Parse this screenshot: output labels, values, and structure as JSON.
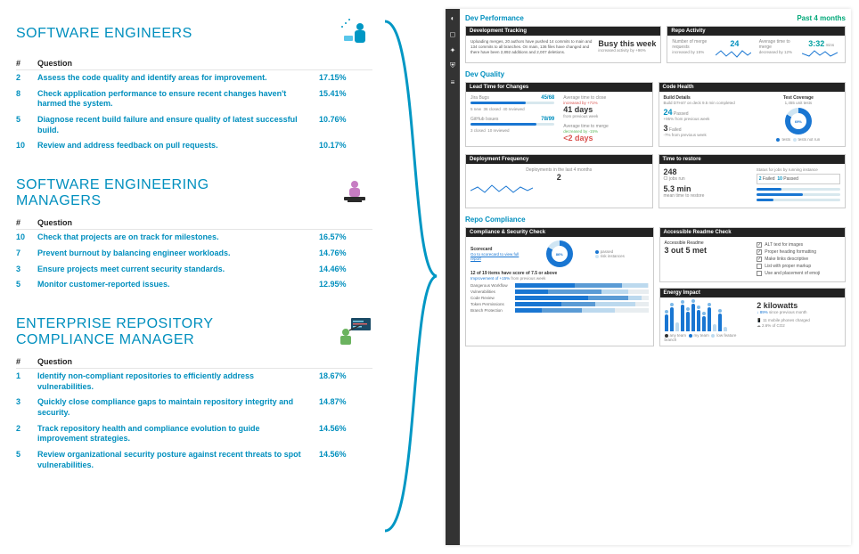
{
  "personas": {
    "se": {
      "title": "SOFTWARE ENGINEERS",
      "rows": [
        {
          "n": "2",
          "q": "Assess the code quality and identify areas for improvement.",
          "pct": "17.15%"
        },
        {
          "n": "8",
          "q": "Check application performance to ensure recent changes haven't harmed the system.",
          "pct": "15.41%"
        },
        {
          "n": "5",
          "q": "Diagnose recent build failure and ensure quality of latest successful build.",
          "pct": "10.76%"
        },
        {
          "n": "10",
          "q": "Review and address feedback on pull requests.",
          "pct": "10.17%"
        }
      ]
    },
    "sem": {
      "title": "SOFTWARE ENGINEERING MANAGERS",
      "rows": [
        {
          "n": "10",
          "q": "Check that projects are on track for milestones.",
          "pct": "16.57%"
        },
        {
          "n": "7",
          "q": "Prevent burnout by balancing engineer workloads.",
          "pct": "14.76%"
        },
        {
          "n": "3",
          "q": "Ensure projects meet current security standards.",
          "pct": "14.46%"
        },
        {
          "n": "5",
          "q": "Monitor customer-reported issues.",
          "pct": "12.95%"
        }
      ]
    },
    "erc": {
      "title": "ENTERPRISE REPOSITORY COMPLIANCE MANAGER",
      "rows": [
        {
          "n": "1",
          "q": "Identify non-compliant repositories to efficiently address vulnerabilities.",
          "pct": "18.67%"
        },
        {
          "n": "3",
          "q": "Quickly close compliance gaps to maintain repository integrity and security.",
          "pct": "14.87%"
        },
        {
          "n": "2",
          "q": "Track repository health and compliance evolution to guide improvement strategies.",
          "pct": "14.56%"
        },
        {
          "n": "5",
          "q": "Review organizational security posture against recent threats to spot vulnerabilities.",
          "pct": "14.56%"
        }
      ]
    },
    "headers": {
      "num": "#",
      "question": "Question"
    }
  },
  "dash": {
    "perf": {
      "title": "Dev Performance",
      "range": "Past 4 months"
    },
    "devtrack": {
      "title": "Development Tracking",
      "summary": "Uploading merges, 20 authors have pushed 14 commits to main and 134 commits to all branches. On main, 136 files have changed and there have been 2,892 additions and 2,007 deletions.",
      "busy": "Busy this week",
      "busy_sub": "increased activity by +96%"
    },
    "repoact": {
      "title": "Repo Activity",
      "merge_label": "Number of merge requests",
      "merge_val": "24",
      "merge_sub": "increased by 15%",
      "time_label": "Average time to merge",
      "time_val": "3:32",
      "time_unit": "mins",
      "time_sub": "decreased by 12%"
    },
    "quality": {
      "title": "Dev Quality"
    },
    "lead": {
      "title": "Lead Time for Changes",
      "bugs_label": "Jira Bugs",
      "bugs_val": "45/68",
      "bugs_legend": [
        "5 new",
        "36 closed",
        "40 reviewed"
      ],
      "close_label": "Average time to close",
      "close_change": "increased by +71%",
      "close_val": "41 days",
      "close_sub": "from previous week",
      "gh_label": "GitHub Issues",
      "gh_val": "78/99",
      "gh_legend": [
        "3 closed",
        "10 reviewed"
      ],
      "merge_label": "Average time to merge",
      "merge_change": "decreased by -15%",
      "merge_val": "<2 days"
    },
    "health": {
      "title": "Code Health",
      "build_label": "Build Details",
      "build_sub": "Build D7H47 on deck 9.5 min completed",
      "passed_val": "24",
      "passed_label": "Passed",
      "passed_note": "+95% from previous week",
      "failed_val": "3",
      "failed_label": "Failed",
      "failed_note": "-7% from previous week",
      "cov_label": "Test Coverage",
      "cov_sub": "1,455 unit tests",
      "cov_pct": "69%",
      "legend_tests": "tests",
      "legend_notrun": "tests not run"
    },
    "deploy": {
      "title": "Deployment Frequency",
      "label": "Deployments in the last 4 months",
      "val": "2"
    },
    "restore": {
      "title": "Time to restore",
      "jobs_val": "248",
      "jobs_label": "CI jobs run",
      "legend1_val": "2",
      "legend1_label": "Failed",
      "legend2_val": "10",
      "legend2_label": "Passed",
      "time_val": "5.3 min",
      "time_label": "mean time to restore",
      "heading": "Status for jobs by running instance"
    },
    "compliance": {
      "title": "Repo Compliance"
    },
    "compcheck": {
      "title": "Compliance & Security Check",
      "scorecard": "Scorecard",
      "link": "Go to scorecard to view full report",
      "donut": "86%",
      "legend_pass": "passed",
      "legend_risk": "risk instances",
      "items_line": "12 of 19 items have score of 7.5 or above",
      "improvement": "Improvement of +15%",
      "from": "from previous week",
      "bars": [
        {
          "label": "Dangerous Workflow"
        },
        {
          "label": "Vulnerabilities"
        },
        {
          "label": "Code Review"
        },
        {
          "label": "Token Permissions"
        },
        {
          "label": "Branch Protection"
        }
      ]
    },
    "readme": {
      "title": "Accessible Readme Check",
      "heading": "Accessible Readme",
      "score": "3 out 5 met",
      "checks": [
        {
          "label": "ALT text for images",
          "ok": true
        },
        {
          "label": "Proper heading formatting",
          "ok": true
        },
        {
          "label": "Make links descriptive",
          "ok": true
        },
        {
          "label": "List with proper markup",
          "ok": false
        },
        {
          "label": "Use and placement of emoji",
          "ok": false
        }
      ]
    },
    "energy": {
      "title": "Energy Impact",
      "val": "2 kilowatts",
      "change": "↓ 89%",
      "change_sub": "since previous month",
      "phones": "11 mobile phones charged",
      "co2": "2.6% of CO2",
      "legend_a": "any team",
      "legend_b": "my team",
      "legend_c": "low feature branch"
    }
  }
}
